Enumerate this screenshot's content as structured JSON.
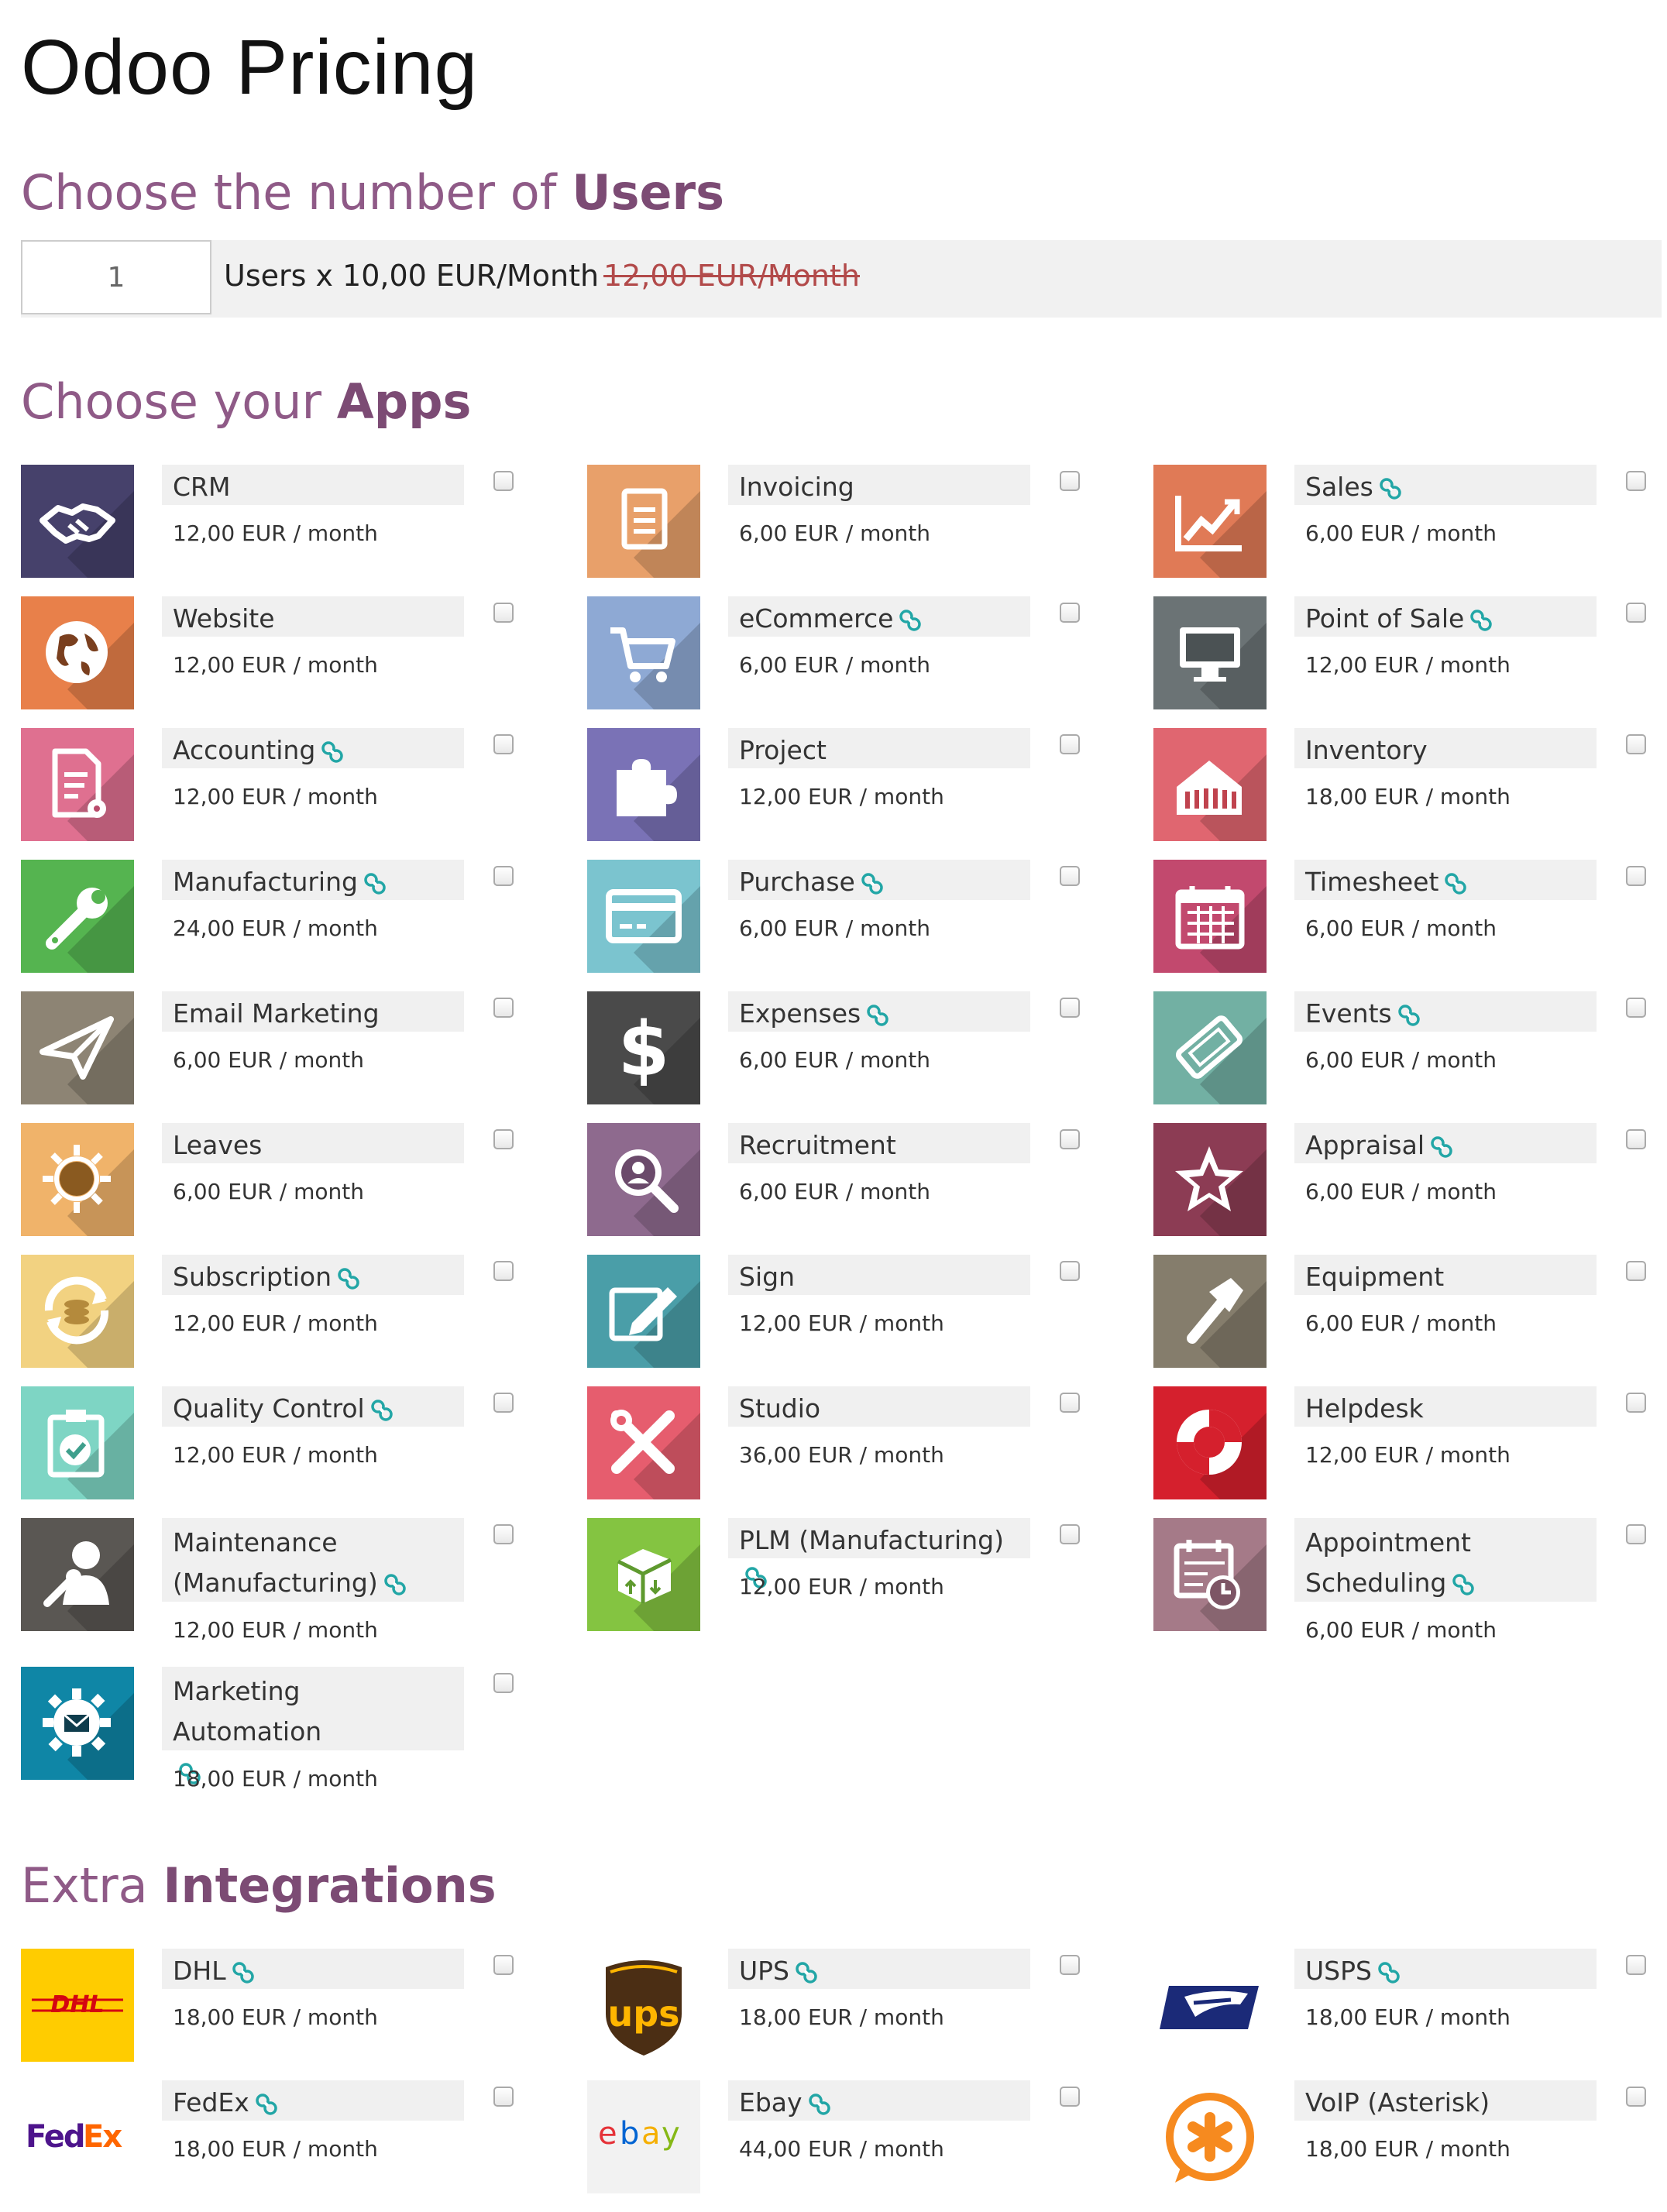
{
  "page_title": "Odoo Pricing",
  "users_section": {
    "heading_light": "Choose the number of",
    "heading_bold": "Users",
    "user_count": "1",
    "price_text": "Users x 10,00 EUR/Month",
    "old_price_text": "12,00 EUR/Month"
  },
  "apps_section": {
    "heading_light": "Choose your",
    "heading_bold": "Apps",
    "apps": [
      {
        "name": "CRM",
        "price": "12,00 EUR / month",
        "linked": false,
        "icon": "handshake-icon",
        "color": "#46416b"
      },
      {
        "name": "Invoicing",
        "price": "6,00 EUR / month",
        "linked": false,
        "icon": "document-icon",
        "color": "#e8a06a"
      },
      {
        "name": "Sales",
        "price": "6,00 EUR / month",
        "linked": true,
        "icon": "chart-trend-icon",
        "color": "#e07a56"
      },
      {
        "name": "Website",
        "price": "12,00 EUR / month",
        "linked": false,
        "icon": "globe-icon",
        "color": "#e8804a"
      },
      {
        "name": "eCommerce",
        "price": "6,00 EUR / month",
        "linked": true,
        "icon": "cart-icon",
        "color": "#8ea9d4"
      },
      {
        "name": "Point of Sale",
        "price": "12,00 EUR / month",
        "linked": true,
        "icon": "monitor-icon",
        "color": "#6b7375"
      },
      {
        "name": "Accounting",
        "price": "12,00 EUR / month",
        "linked": true,
        "icon": "document-gear-icon",
        "color": "#df7090"
      },
      {
        "name": "Project",
        "price": "12,00 EUR / month",
        "linked": false,
        "icon": "puzzle-icon",
        "color": "#7a72b6"
      },
      {
        "name": "Inventory",
        "price": "18,00 EUR / month",
        "linked": false,
        "icon": "box-icon",
        "color": "#e06670"
      },
      {
        "name": "Manufacturing",
        "price": "24,00 EUR / month",
        "linked": true,
        "icon": "wrench-icon",
        "color": "#55b450"
      },
      {
        "name": "Purchase",
        "price": "6,00 EUR / month",
        "linked": true,
        "icon": "credit-card-icon",
        "color": "#7bc4cf"
      },
      {
        "name": "Timesheet",
        "price": "6,00 EUR / month",
        "linked": true,
        "icon": "calendar-icon",
        "color": "#c2496e"
      },
      {
        "name": "Email Marketing",
        "price": "6,00 EUR / month",
        "linked": false,
        "icon": "paper-plane-icon",
        "color": "#8d8474"
      },
      {
        "name": "Expenses",
        "price": "6,00 EUR / month",
        "linked": true,
        "icon": "dollar-icon",
        "color": "#4a4a4a"
      },
      {
        "name": "Events",
        "price": "6,00 EUR / month",
        "linked": true,
        "icon": "ticket-icon",
        "color": "#72b0a3"
      },
      {
        "name": "Leaves",
        "price": "6,00 EUR / month",
        "linked": false,
        "icon": "sun-icon",
        "color": "#f0b36a"
      },
      {
        "name": "Recruitment",
        "price": "6,00 EUR / month",
        "linked": false,
        "icon": "magnifier-user-icon",
        "color": "#8e6a8e"
      },
      {
        "name": "Appraisal",
        "price": "6,00 EUR / month",
        "linked": true,
        "icon": "star-icon",
        "color": "#8c3c54"
      },
      {
        "name": "Subscription",
        "price": "12,00 EUR / month",
        "linked": true,
        "icon": "refresh-coins-icon",
        "color": "#f2d281"
      },
      {
        "name": "Sign",
        "price": "12,00 EUR / month",
        "linked": false,
        "icon": "pen-edit-icon",
        "color": "#4a9ea8"
      },
      {
        "name": "Equipment",
        "price": "6,00 EUR / month",
        "linked": false,
        "icon": "hammer-icon",
        "color": "#857d6c"
      },
      {
        "name": "Quality Control",
        "price": "12,00 EUR / month",
        "linked": true,
        "icon": "clipboard-check-icon",
        "color": "#7ed5c4"
      },
      {
        "name": "Studio",
        "price": "36,00 EUR / month",
        "linked": false,
        "icon": "tools-icon",
        "color": "#e65d6e"
      },
      {
        "name": "Helpdesk",
        "price": "12,00 EUR / month",
        "linked": false,
        "icon": "lifebuoy-icon",
        "color": "#d5202d"
      },
      {
        "name": "Maintenance",
        "name_line2": "(Manufacturing)",
        "price": "12,00 EUR / month",
        "linked": true,
        "icon": "user-wrench-icon",
        "color": "#5a5753"
      },
      {
        "name": "PLM (Manufacturing)",
        "price": "12,00 EUR / month",
        "linked": true,
        "icon": "package-icon",
        "color": "#84c441"
      },
      {
        "name": "Appointment",
        "name_line2": "Scheduling",
        "price": "6,00 EUR / month",
        "linked": true,
        "icon": "calendar-clock-icon",
        "color": "#a57a88"
      },
      {
        "name": "Marketing Automation",
        "price": "18,00 EUR / month",
        "linked": true,
        "icon": "gear-mail-icon",
        "color": "#0f86a6"
      }
    ]
  },
  "integrations_section": {
    "heading_light": "Extra",
    "heading_bold": "Integrations",
    "items": [
      {
        "name": "DHL",
        "price": "18,00 EUR / month",
        "linked": true,
        "icon": "dhl-logo-icon"
      },
      {
        "name": "UPS",
        "price": "18,00 EUR / month",
        "linked": true,
        "icon": "ups-logo-icon"
      },
      {
        "name": "USPS",
        "price": "18,00 EUR / month",
        "linked": true,
        "icon": "usps-logo-icon"
      },
      {
        "name": "FedEx",
        "price": "18,00 EUR / month",
        "linked": true,
        "icon": "fedex-logo-icon"
      },
      {
        "name": "Ebay",
        "price": "44,00 EUR / month",
        "linked": true,
        "icon": "ebay-logo-icon"
      },
      {
        "name": "VoIP (Asterisk)",
        "price": "18,00 EUR / month",
        "linked": false,
        "icon": "asterisk-logo-icon"
      }
    ]
  },
  "colors": {
    "heading_purple": "#8f5a87",
    "link_teal": "#22a6a6",
    "strike_red": "#b24a4a"
  }
}
